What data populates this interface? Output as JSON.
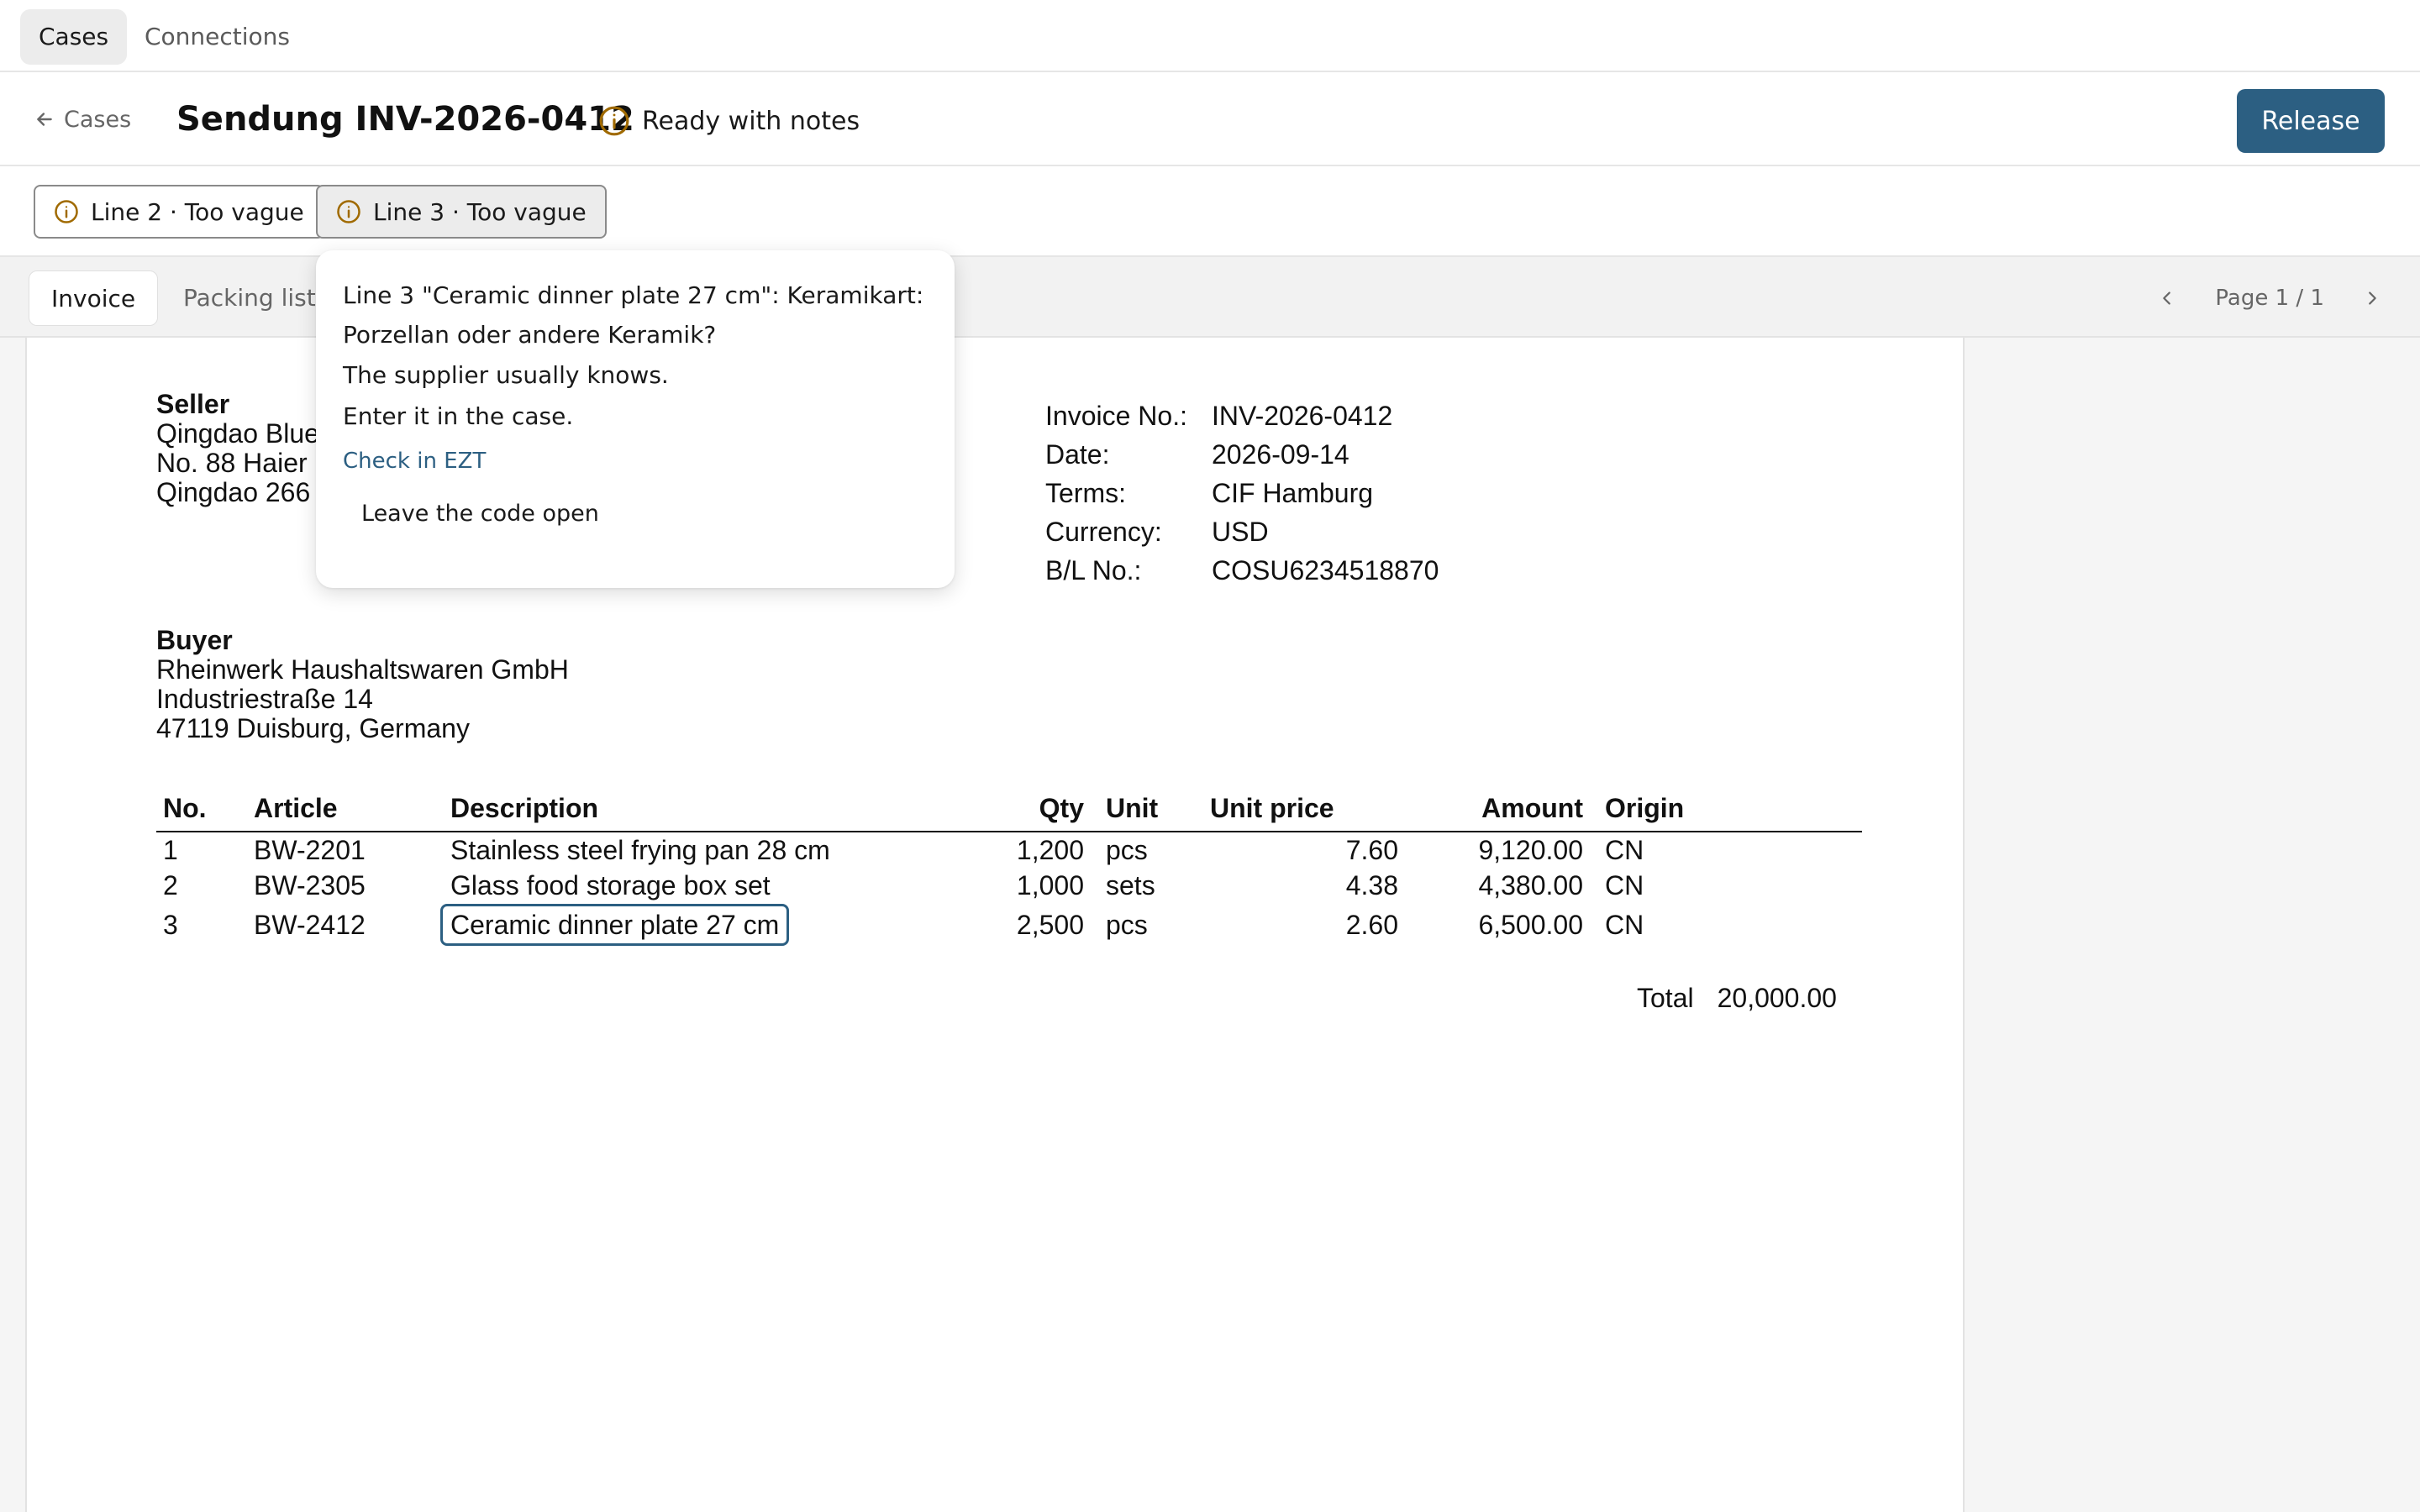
{
  "nav": {
    "tabs": [
      {
        "label": "Cases",
        "active": true
      },
      {
        "label": "Connections",
        "active": false
      }
    ]
  },
  "header": {
    "back_label": "Cases",
    "title": "Sendung INV-2026-0412",
    "status": "Ready with notes",
    "release_label": "Release"
  },
  "issues": [
    {
      "label": "Line 2 · Too vague",
      "active": false
    },
    {
      "label": "Line 3 · Too vague",
      "active": true
    }
  ],
  "doc_tabs": [
    {
      "label": "Invoice",
      "active": true
    },
    {
      "label": "Packing list",
      "active": false
    }
  ],
  "pager": {
    "label": "Page 1 / 1"
  },
  "invoice": {
    "seller_label": "Seller",
    "seller_lines": [
      "Qingdao Blue",
      "No. 88 Haier",
      "Qingdao 266"
    ],
    "buyer_label": "Buyer",
    "buyer_lines": [
      "Rheinwerk Haushaltswaren GmbH",
      "Industriestraße 14",
      "47119 Duisburg, Germany"
    ],
    "meta": [
      {
        "key": "Invoice No.:",
        "value": "INV-2026-0412"
      },
      {
        "key": "Date:",
        "value": "2026-09-14"
      },
      {
        "key": "Terms:",
        "value": "CIF Hamburg"
      },
      {
        "key": "Currency:",
        "value": "USD"
      },
      {
        "key": "B/L No.:",
        "value": "COSU6234518870"
      }
    ],
    "columns": [
      "No.",
      "Article",
      "Description",
      "Qty",
      "Unit",
      "Unit price",
      "Amount",
      "Origin"
    ],
    "rows": [
      {
        "no": "1",
        "article": "BW-2201",
        "description": "Stainless steel frying pan 28 cm",
        "qty": "1,200",
        "unit": "pcs",
        "unit_price": "7.60",
        "amount": "9,120.00",
        "origin": "CN"
      },
      {
        "no": "2",
        "article": "BW-2305",
        "description": "Glass food storage box set",
        "qty": "1,000",
        "unit": "sets",
        "unit_price": "4.38",
        "amount": "4,380.00",
        "origin": "CN"
      },
      {
        "no": "3",
        "article": "BW-2412",
        "description": "Ceramic dinner plate 27 cm",
        "qty": "2,500",
        "unit": "pcs",
        "unit_price": "2.60",
        "amount": "6,500.00",
        "origin": "CN"
      }
    ],
    "total_label": "Total",
    "total_value": "20,000.00"
  },
  "popover": {
    "question": "Line 3 \"Ceramic dinner plate 27 cm\": Keramikart:\nPorzellan oder andere Keramik?",
    "hints": [
      "The supplier usually knows.",
      "Enter it in the case."
    ],
    "link_label": "Check in EZT",
    "action_label": "Leave the code open"
  },
  "colors": {
    "accent": "#2c5f82",
    "warning_icon": "#a06a00",
    "highlight_border": "#2c5f82"
  }
}
